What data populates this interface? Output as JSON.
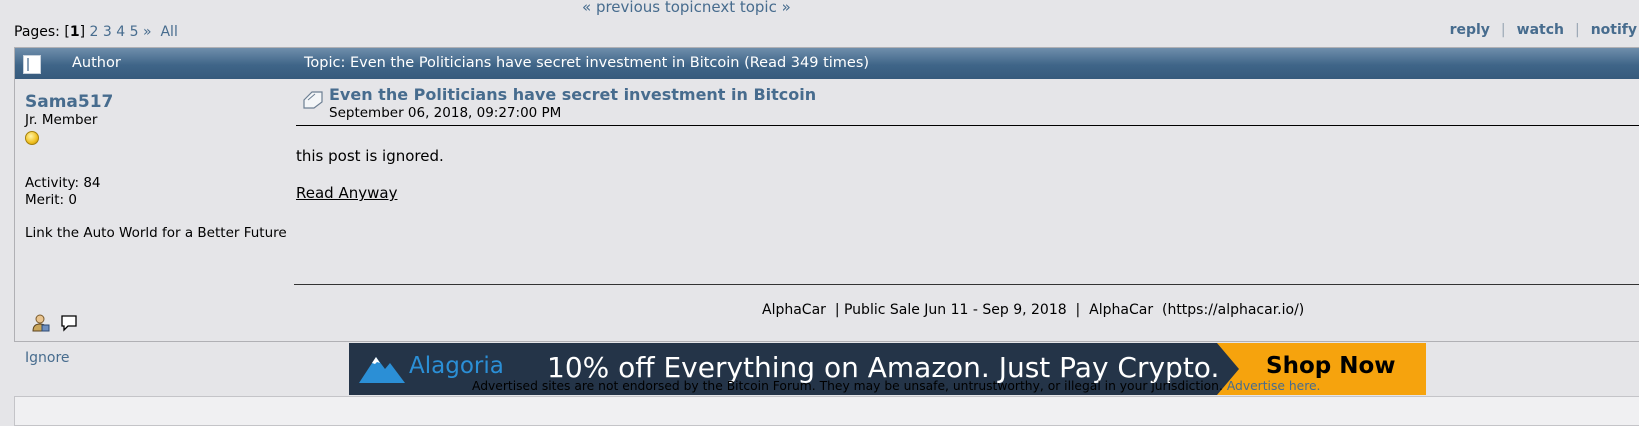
{
  "topnav": {
    "previous": "« previous topic",
    "next": "next topic »"
  },
  "pagination": {
    "label": "Pages: [",
    "current": "1",
    "close": "]",
    "pages": [
      "2",
      "3",
      "4",
      "5"
    ],
    "more": "»",
    "all": "All"
  },
  "actions": [
    "reply",
    "watch",
    "notify"
  ],
  "header": {
    "author": "Author",
    "topic": "Topic: Even the Politicians have secret investment in Bitcoin  (Read 349 times)"
  },
  "poster": {
    "name": "Sama517",
    "rank": "Jr. Member",
    "activity": "Activity: 84",
    "merit": "Merit: 0",
    "tagline": "Link the Auto World for a Better Future",
    "ignore": "Ignore"
  },
  "post": {
    "title": "Even the Politicians have secret investment in Bitcoin",
    "date": "September 06, 2018, 09:27:00 PM",
    "ignored_text": "this post is ignored.",
    "read_anyway": "Read Anyway",
    "signature": "AlphaCar  | Public Sale Jun 11 - Sep 9, 2018  |  AlphaCar  (https://alphacar.io/)"
  },
  "ad": {
    "brand": "Alagoria",
    "text": "10% off Everything on Amazon. Just Pay Crypto.",
    "cta": "Shop Now",
    "disclaimer": "Advertised sites are not endorsed by the Bitcoin Forum. They may be unsafe, untrustworthy, or illegal in your jurisdiction.",
    "advertise_link": "Advertise here."
  },
  "icons": [
    "topic-icon",
    "coin-icon",
    "profile-icon",
    "message-icon",
    "post-icon",
    "mountain-logo-icon"
  ],
  "colors": {
    "link": "#476c8e",
    "header_bg": "#3f6588",
    "page_bg": "#e5e5e8",
    "ad_dark": "#243448",
    "ad_orange": "#f6a30d",
    "ad_brand": "#2b8fd6"
  }
}
